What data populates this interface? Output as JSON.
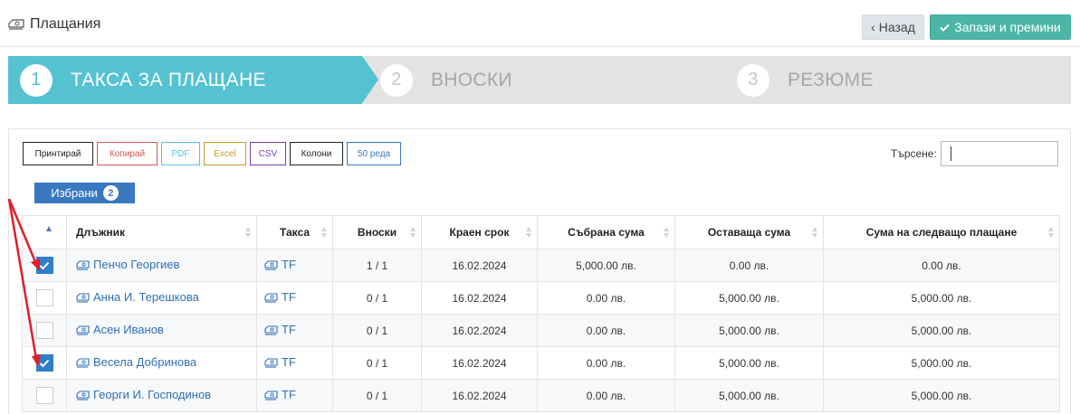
{
  "header": {
    "title": "Плащания",
    "back_label": "Назад",
    "save_label": "Запази и премини"
  },
  "steps": [
    {
      "number": "1",
      "label": "ТАКСА ЗА ПЛАЩАНЕ",
      "active": true
    },
    {
      "number": "2",
      "label": "ВНОСКИ",
      "active": false
    },
    {
      "number": "3",
      "label": "РЕЗЮМЕ",
      "active": false
    }
  ],
  "toolbar": {
    "print": "Принтирай",
    "copy": "Копирай",
    "pdf": "PDF",
    "excel": "Excel",
    "csv": "CSV",
    "columns": "Колони",
    "rows": "50 реда"
  },
  "colors": {
    "accent": "#55c2d2",
    "save": "#4cb6a6",
    "print": "#222222",
    "copy": "#d9534f",
    "pdf": "#5bc0de",
    "excel": "#c49a2a",
    "csv": "#7b3f9e",
    "columns": "#222222",
    "rows": "#3a78c0",
    "annotation": "#e11d2a"
  },
  "search": {
    "label": "Търсене:",
    "value": ""
  },
  "selected": {
    "label": "Избрани",
    "count": "2"
  },
  "table": {
    "headers": [
      "Длъжник",
      "Такса",
      "Вноски",
      "Краен срок",
      "Събрана сума",
      "Оставаща сума",
      "Сума на следващо плащане"
    ],
    "rows": [
      {
        "checked": true,
        "debtor": "Пенчо Георгиев",
        "fee": "TF",
        "installments": "1 / 1",
        "due": "16.02.2024",
        "collected": "5,000.00 лв.",
        "remaining": "0.00 лв.",
        "next": "0.00 лв."
      },
      {
        "checked": false,
        "debtor": "Анна И. Терешкова",
        "fee": "TF",
        "installments": "0 / 1",
        "due": "16.02.2024",
        "collected": "0.00 лв.",
        "remaining": "5,000.00 лв.",
        "next": "5,000.00 лв."
      },
      {
        "checked": false,
        "debtor": "Асен Иванов",
        "fee": "TF",
        "installments": "0 / 1",
        "due": "16.02.2024",
        "collected": "0.00 лв.",
        "remaining": "5,000.00 лв.",
        "next": "5,000.00 лв."
      },
      {
        "checked": true,
        "debtor": "Весела Добринова",
        "fee": "TF",
        "installments": "0 / 1",
        "due": "16.02.2024",
        "collected": "0.00 лв.",
        "remaining": "5,000.00 лв.",
        "next": "5,000.00 лв."
      },
      {
        "checked": false,
        "debtor": "Георги И. Господинов",
        "fee": "TF",
        "installments": "0 / 1",
        "due": "16.02.2024",
        "collected": "0.00 лв.",
        "remaining": "5,000.00 лв.",
        "next": "5,000.00 лв."
      }
    ]
  }
}
